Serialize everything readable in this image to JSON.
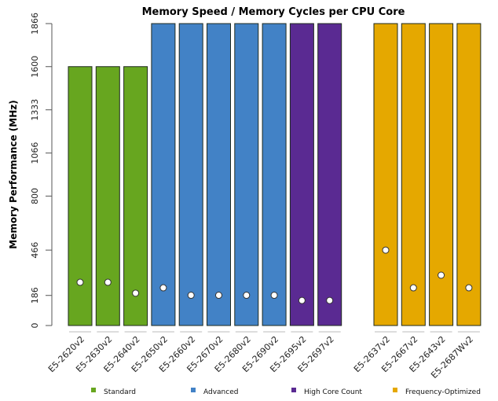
{
  "chart_data": {
    "type": "bar",
    "title": "Memory Speed / Memory Cycles per CPU Core",
    "xlabel": "",
    "ylabel": "Memory Performance (MHz)",
    "ylim": [
      0,
      1866
    ],
    "yticks": [
      0,
      186,
      466,
      800,
      1066,
      1333,
      1600,
      1866
    ],
    "grid": false,
    "legend_position": "bottom",
    "groups": [
      {
        "name": "Standard",
        "color": "#67a61f"
      },
      {
        "name": "Advanced",
        "color": "#4282c6"
      },
      {
        "name": "High Core Count",
        "color": "#5a2a92"
      },
      {
        "name": "Frequency-Optimized",
        "color": "#e5a800"
      }
    ],
    "categories": [
      "E5-2620v2",
      "E5-2630v2",
      "E5-2640v2",
      "E5-2650v2",
      "E5-2660v2",
      "E5-2670v2",
      "E5-2680v2",
      "E5-2690v2",
      "E5-2695v2",
      "E5-2697v2",
      "E5-2637v2",
      "E5-2667v2",
      "E5-2643v2",
      "E5-2687Wv2"
    ],
    "category_groups": [
      "Standard",
      "Standard",
      "Standard",
      "Advanced",
      "Advanced",
      "Advanced",
      "Advanced",
      "Advanced",
      "High Core Count",
      "High Core Count",
      "Frequency-Optimized",
      "Frequency-Optimized",
      "Frequency-Optimized",
      "Frequency-Optimized"
    ],
    "series": [
      {
        "name": "Memory Speed",
        "marker": "bar",
        "values": [
          1600,
          1600,
          1600,
          1866,
          1866,
          1866,
          1866,
          1866,
          1866,
          1866,
          1866,
          1866,
          1866,
          1866
        ]
      },
      {
        "name": "Memory Cycles per CPU Core",
        "marker": "dot",
        "values": [
          267,
          267,
          200,
          233,
          187,
          187,
          187,
          187,
          155,
          155,
          466,
          233,
          311,
          233
        ]
      }
    ]
  }
}
